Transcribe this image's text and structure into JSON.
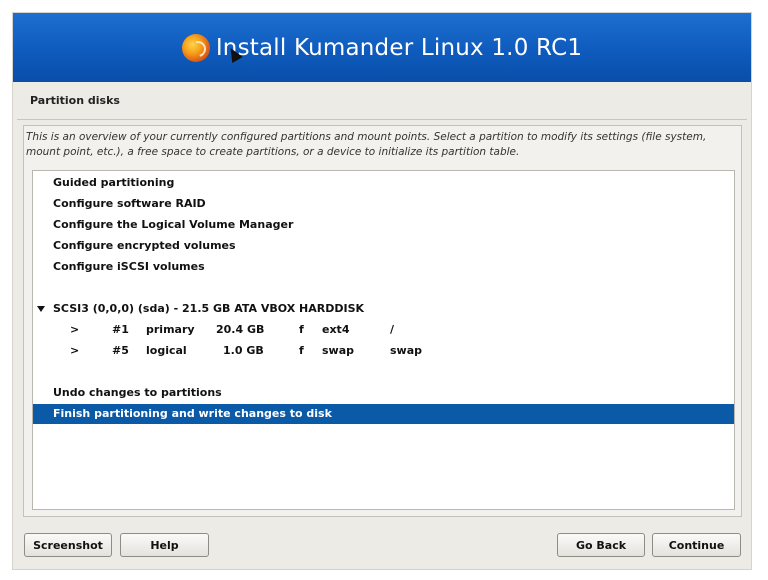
{
  "header": {
    "title": "Install Kumander Linux 1.0 RC1",
    "logo_icon": "kumander-swirl-icon"
  },
  "page": {
    "section_title": "Partition disks",
    "description": "This is an overview of your currently configured partitions and mount points. Select a partition to modify its settings (file system, mount point, etc.), a free space to create partitions, or a device to initialize its partition table."
  },
  "menu": {
    "guided": "Guided partitioning",
    "raid": "Configure software RAID",
    "lvm": "Configure the Logical Volume Manager",
    "encrypted": "Configure encrypted volumes",
    "iscsi": "Configure iSCSI volumes"
  },
  "disk": {
    "label": "SCSI3 (0,0,0) (sda) - 21.5 GB ATA VBOX HARDDISK",
    "partitions": [
      {
        "arrow": ">",
        "num": "#1",
        "type": "primary",
        "size": "20.4 GB",
        "flag": "f",
        "fs": "ext4",
        "mount": "/"
      },
      {
        "arrow": ">",
        "num": "#5",
        "type": "logical",
        "size": "1.0 GB",
        "flag": "f",
        "fs": "swap",
        "mount": "swap"
      }
    ]
  },
  "actions": {
    "undo": "Undo changes to partitions",
    "finish": "Finish partitioning and write changes to disk"
  },
  "buttons": {
    "screenshot": "Screenshot",
    "help": "Help",
    "back": "Go Back",
    "continue": "Continue"
  },
  "colors": {
    "banner": "#0e5bbd",
    "selection": "#0b5aa8",
    "background": "#edebe6"
  }
}
